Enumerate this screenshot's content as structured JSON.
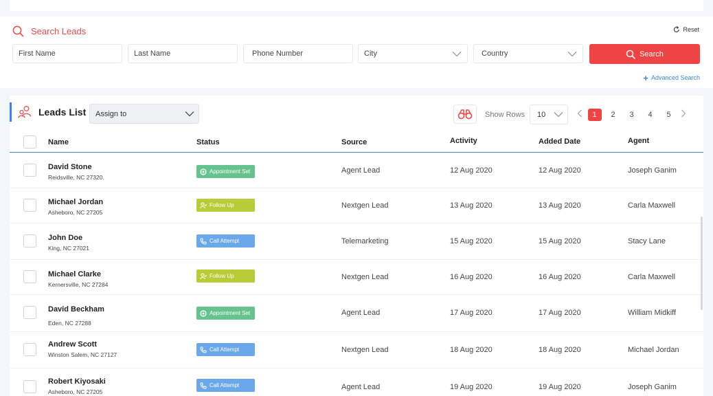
{
  "search": {
    "title": "Search Leads",
    "reset": "Reset",
    "first_name_placeholder": "First Name",
    "last_name_placeholder": "Last Name",
    "phone_placeholder": "Phone Number",
    "city": "City",
    "country": "Country",
    "button": "Search",
    "advanced": "Advanced Search"
  },
  "leads": {
    "title": "Leads List",
    "assign": "Assign to",
    "show_rows_label": "Show Rows",
    "rows_value": "10",
    "pages": [
      "1",
      "2",
      "3",
      "4",
      "5"
    ],
    "columns": [
      "Name",
      "Status",
      "Source",
      "Activity",
      "Added Date",
      "Agent"
    ],
    "rows": [
      {
        "name": "David Stone",
        "address": "Reidsville, NC 27320.",
        "status": "Appointment Set",
        "source": "Agent Lead",
        "activity": "12 Aug 2020",
        "added": "12 Aug 2020",
        "agent": "Joseph Ganim"
      },
      {
        "name": "Michael Jordan",
        "address": "Asheboro, NC 27205",
        "status": "Follow Up",
        "source": "Nextgen Lead",
        "activity": "13 Aug 2020",
        "added": "13 Aug 2020",
        "agent": "Carla Maxwell"
      },
      {
        "name": "John Doe",
        "address": "King, NC 27021",
        "status": "Call Attempt",
        "source": "Telemarketing",
        "activity": "15 Aug 2020",
        "added": "15 Aug 2020",
        "agent": "Stacy Lane"
      },
      {
        "name": "Michael Clarke",
        "address": "Kernersville, NC 27284",
        "status": "Follow Up",
        "source": "Nextgen Lead",
        "activity": "16 Aug 2020",
        "added": "16 Aug 2020",
        "agent": "Carla Maxwell"
      },
      {
        "name": "David Beckham",
        "address": "Eden, NC 27288",
        "status": "Appointment Set",
        "source": "Agent Lead",
        "activity": "17 Aug 2020",
        "added": "17 Aug 2020",
        "agent": "William Midkiff"
      },
      {
        "name": "Andrew Scott",
        "address": "Winston Salem, NC 27127",
        "status": "Call Attempt",
        "source": "Nextgen Lead",
        "activity": "18 Aug 2020",
        "added": "18 Aug 2020",
        "agent": "Michael Jordan"
      },
      {
        "name": "Robert Kiyosaki",
        "address": "Asheboro, NC 27205",
        "status": "Call Attempt",
        "source": "Agent Lead",
        "activity": "19 Aug 2020",
        "added": "19 Aug 2020",
        "agent": "Joseph Ganim"
      }
    ]
  },
  "colors": {
    "accent_red": "#ef4444",
    "link_blue": "#3a8bd6",
    "appointment_set": "#66c28e",
    "follow_up": "#b8cc38",
    "call_attempt": "#6aa8ea"
  }
}
